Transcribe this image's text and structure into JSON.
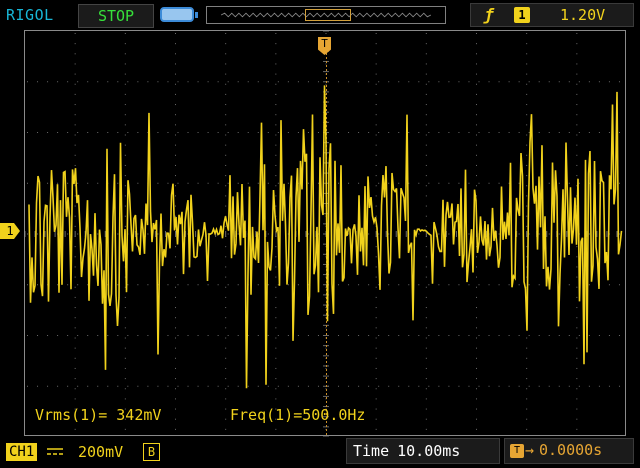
{
  "header": {
    "brand": "RIGOL",
    "run_state": "STOP",
    "trigger_channel": "1",
    "trigger_level": "1.20V",
    "trigger_edge": "rising-edge-icon"
  },
  "screen": {
    "channel_marker": "1",
    "trigger_marker": "T",
    "trace_color": "#f1d21c"
  },
  "measurements": {
    "vrms": "Vrms(1)= 342mV",
    "freq": "Freq(1)=500.0Hz"
  },
  "footer": {
    "channel_label": "CH1",
    "coupling_icon": "dc-coupling-icon",
    "volts_per_div": "200mV",
    "bandwidth_limit": "B",
    "time_label": "Time",
    "time_per_div": "10.00ms",
    "trigger_offset_icon": "T",
    "trigger_offset": "0.0000s"
  },
  "colors": {
    "brand": "#18b6d6",
    "run_state": "#36e13a",
    "channel": "#f1d21c",
    "trigger": "#e6a533"
  }
}
